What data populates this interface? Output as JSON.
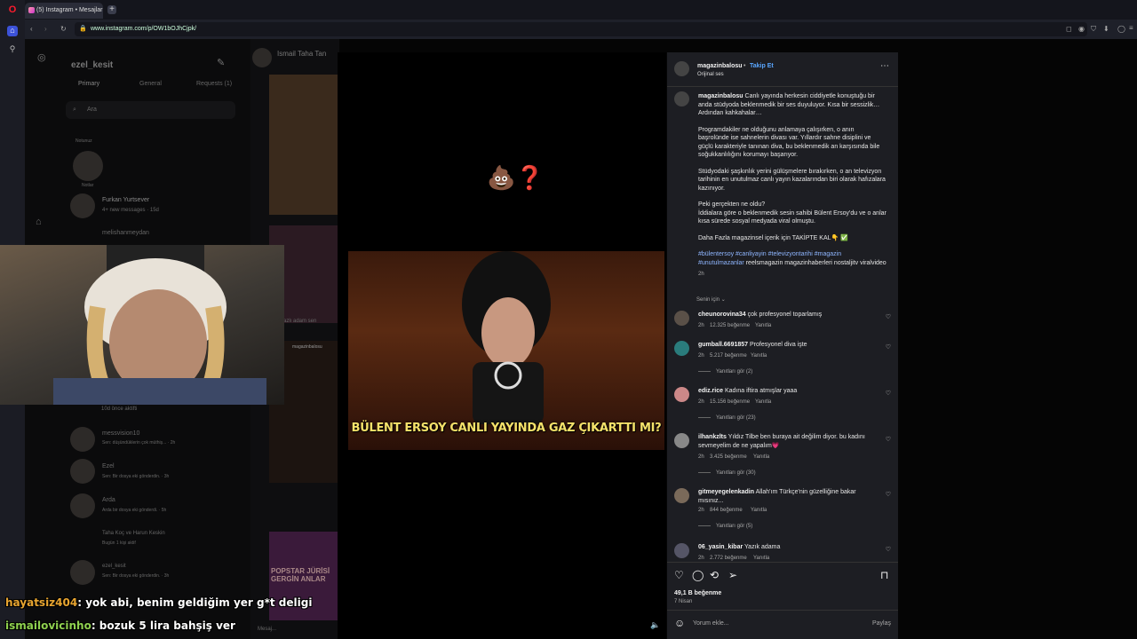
{
  "browser": {
    "tab_title": "(5) Instagram • Mesajlar",
    "new_tab": "+",
    "url": "www.instagram.com/p/OW1bOJhCjpk/"
  },
  "dm": {
    "username": "ezel_kesit",
    "tabs": [
      "Primary",
      "General",
      "Requests (1)"
    ],
    "search_placeholder": "Ara",
    "notes_label": "Notunuz",
    "note_name": "Notlar",
    "header_name": "Ismail Taha Tan",
    "threads": [
      {
        "name": "Furkan Yurtsever",
        "preview": "4+ new messages · 15d"
      },
      {
        "name": "melishanmeydan",
        "preview": ""
      },
      {
        "name": "",
        "preview": "10d önce aktifti"
      },
      {
        "name": "messvision10",
        "preview": "Sen: düşündüklerin çok müthiş... · 2h"
      },
      {
        "name": "Ezel",
        "preview": "Sen: Bir dosya eki gönderdin. · 3h"
      },
      {
        "name": "Arda",
        "preview": "Arda bir dosya eki gönderdi. · 5h"
      },
      {
        "name": "Taha Koç ve Harun Keskin",
        "preview": "Bugün 1 kişi aktif"
      },
      {
        "name": "ezel_kesit",
        "preview": "Sen: Bir dosya eki gönderdin. · 3h"
      }
    ],
    "reel_caption_bits": [
      "magazinbalosu",
      "Bülent Ersoy Canlı Yayında Gaz Çıkarttı Mı?",
      "azlı adam sen",
      "POPSTAR JÜRİSİ GERGİN ANLAR"
    ],
    "message_placeholder": "Mesaj..."
  },
  "video": {
    "emoji": "💩❓",
    "caption": "BÜLENT ERSOY CANLI YAYINDA GAZ ÇIKARTTI MI?"
  },
  "post": {
    "account": "magazinbalosu",
    "follow_label": "Takip Et",
    "audio": "Orijinal ses",
    "caption_paragraphs": [
      "Canlı yayında herkesin ciddiyetle konuştuğu bir anda stüdyoda beklenmedik bir ses duyuluyor. Kısa bir sessizlik… Ardından kahkahalar…",
      "Programdakiler ne olduğunu anlamaya çalışırken, o anın başrolünde ise sahnelerin divası var. Yıllardır sahne disiplini ve güçlü karakteriyle tanınan diva, bu beklenmedik an karşısında bile soğukkanlılığını korumayı başarıyor.",
      "Stüdyodaki şaşkınlık yerini gülüşmelere bırakırken, o an televizyon tarihinin en unutulmaz canlı yayın kazalarından biri olarak hafızalara kazınıyor.",
      "Peki gerçekten ne oldu?",
      "İddialara göre o beklenmedik sesin sahibi Bülent Ersoy'du ve o anlar kısa sürede sosyal medyada viral olmuştu.",
      "Daha Fazla magazinsel içerik için TAKİPTE KAL👇 ✅"
    ],
    "hashtags": "#bülentersoy #canliyayin #televizyontarihi #magazin #unutulmazanlar",
    "hashtags_tail": "reelsmagazin magazinhaberleri nostaljitv viralvideo",
    "caption_time": "2h",
    "sort_label": "Senin için",
    "comments": [
      {
        "user": "cheunorovina34",
        "text": "çok profesyonel toparlamış",
        "time": "2h",
        "likes": "12.325 beğenme",
        "reply": "Yanıtla",
        "view_replies": ""
      },
      {
        "user": "gumball.6691857",
        "text": "Profesyonel diva işte",
        "time": "2h",
        "likes": "5.217 beğenme",
        "reply": "Yanıtla",
        "view_replies": "Yanıtları gör (2)"
      },
      {
        "user": "ediz.rice",
        "text": "Kadına iftira atmışlar yaaa",
        "time": "2h",
        "likes": "15.156 beğenme",
        "reply": "Yanıtla",
        "view_replies": "Yanıtları gör (23)"
      },
      {
        "user": "ilhankzlts",
        "text": "Yıldız Tilbe ben buraya ait değilim diyor. bu kadını sevmeyelim de ne yapalım💗",
        "time": "2h",
        "likes": "3.425 beğenme",
        "reply": "Yanıtla",
        "view_replies": "Yanıtları gör (30)"
      },
      {
        "user": "gitmeyegelenkadin",
        "text": "Allah'ım Türkçe'nin güzelliğine bakar mısınız...",
        "time": "2h",
        "likes": "844 beğenme",
        "reply": "Yanıtla",
        "view_replies": "Yanıtları gör (5)"
      },
      {
        "user": "06_yasin_kibar",
        "text": "Yazık adama",
        "time": "2h",
        "likes": "2.772 beğenme",
        "reply": "Yanıtla",
        "view_replies": ""
      }
    ],
    "likes_total": "49,1 B beğenme",
    "date": "7 Nisan",
    "comment_placeholder": "Yorum ekle...",
    "share_button": "Paylaş"
  },
  "chat": [
    {
      "user": "hayatsiz404",
      "message": ": yok abi, benim geldiğim yer g*t deligi",
      "color": "#e8a530"
    },
    {
      "user": "ismailovicinho",
      "message": ": bozuk 5 lira bahşiş ver",
      "color": "#8fd14f"
    }
  ],
  "colors": {
    "link": "#5aa7ff",
    "panel_bg": "#1d1e23",
    "opera_red": "#ff1b2d"
  }
}
